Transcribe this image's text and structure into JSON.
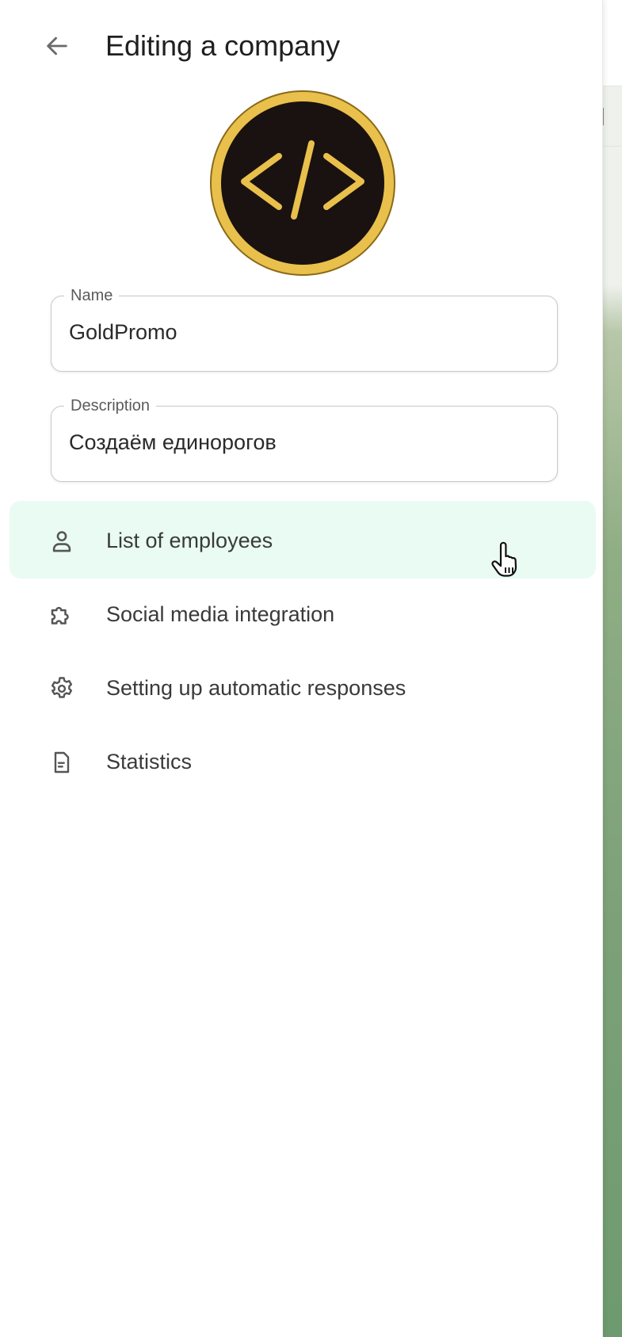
{
  "header": {
    "title": "Editing a company",
    "back_icon": "arrow-left-icon"
  },
  "logo": {
    "glyph": "</>",
    "icon": "code-icon",
    "colors": {
      "ring": "#e9c04c",
      "background": "#1a1210",
      "glyph": "#e9c04c"
    }
  },
  "form": {
    "name": {
      "label": "Name",
      "value": "GoldPromo"
    },
    "description": {
      "label": "Description",
      "value": "Создаём единорогов"
    }
  },
  "menu": {
    "items": [
      {
        "label": "List of employees",
        "icon": "user-icon",
        "active": true
      },
      {
        "label": "Social media integration",
        "icon": "puzzle-icon",
        "active": false
      },
      {
        "label": "Setting up automatic responses",
        "icon": "gear-icon",
        "active": false
      },
      {
        "label": "Statistics",
        "icon": "document-icon",
        "active": false
      }
    ]
  },
  "colors": {
    "active_item_bg": "#e9fbf3",
    "text_primary": "#1f1f1f",
    "border": "#c9c9c9"
  }
}
